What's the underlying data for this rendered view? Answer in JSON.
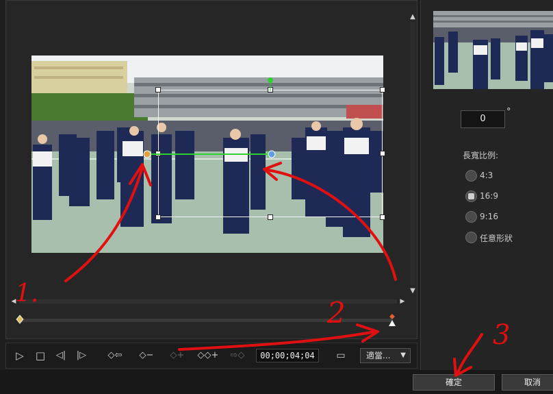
{
  "preview": {
    "scroll_up_glyph": "▲",
    "scroll_down_glyph": "▼",
    "scroll_left_glyph": "◀",
    "scroll_right_glyph": "▶"
  },
  "toolbar": {
    "play_icon": "▷",
    "stop_icon": "□",
    "prev_frame_icon": "◁|",
    "next_frame_icon": "|▷",
    "prev_keyframe_icon": "◇⇦",
    "remove_keyframe_icon": "◇−",
    "add_keyframe_icon": "◇+",
    "duplicate_keyframe_icon": "◇◇+",
    "next_keyframe_icon": "⇨◇",
    "timecode": "00;00;04;04",
    "safe_area_icon": "▭",
    "fit_select_value": "適當...",
    "fit_caret": "▼"
  },
  "right_panel": {
    "rotation_value": "0",
    "degree_symbol": "°",
    "aspect_label": "長寬比例:",
    "aspect_options": [
      {
        "label": "4:3",
        "checked": false
      },
      {
        "label": "16:9",
        "checked": true
      },
      {
        "label": "9:16",
        "checked": false
      },
      {
        "label": "任意形狀",
        "checked": false
      }
    ]
  },
  "buttons": {
    "ok": "確定",
    "cancel": "取消"
  },
  "annotations": {
    "mark_1": "1.",
    "mark_2": "2",
    "mark_3": "3"
  },
  "colors": {
    "keyframe_start": "#e0c060",
    "keyframe_end": "#e06030",
    "motion_path": "#2fd02f",
    "annotation_red": "#e01010"
  }
}
